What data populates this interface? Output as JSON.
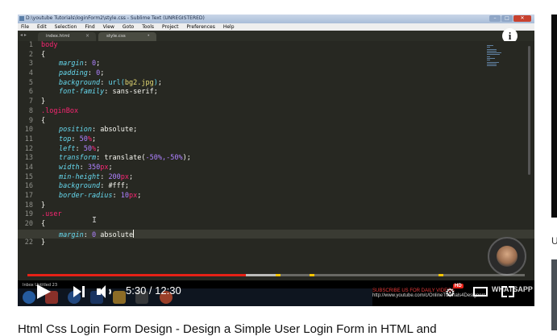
{
  "window": {
    "title": "D:\\youtube Tutorials\\loginForm2\\style.css - Sublime Text (UNREGISTERED)",
    "buttons": [
      "–",
      "□",
      "✕"
    ]
  },
  "menu": [
    "File",
    "Edit",
    "Selection",
    "Find",
    "View",
    "Goto",
    "Tools",
    "Project",
    "Preferences",
    "Help"
  ],
  "tabs": [
    {
      "label": "index.html",
      "close": "×",
      "active": false
    },
    {
      "label": "style.css",
      "close": "•",
      "active": true
    }
  ],
  "tab_nav": "◂ ▸",
  "info_button": "i",
  "line_numbers": [
    "1",
    "2",
    "3",
    "4",
    "5",
    "6",
    "7",
    "8",
    "9",
    "10",
    "11",
    "12",
    "13",
    "14",
    "15",
    "16",
    "17",
    "18",
    "19",
    "20",
    "21",
    "22"
  ],
  "code": {
    "l1": "body",
    "l2": "{",
    "l3": {
      "prop": "margin",
      "num": "0"
    },
    "l4": {
      "prop": "padding",
      "num": "0"
    },
    "l5": {
      "prop": "background",
      "func": "url(",
      "str": "bg2.jpg",
      "close": ")"
    },
    "l6": {
      "prop": "font-family",
      "val": "sans-serif"
    },
    "l7": "}",
    "l8": ".loginBox",
    "l9": "{",
    "l10": {
      "prop": "position",
      "val": "absolute"
    },
    "l11": {
      "prop": "top",
      "num": "50",
      "unit": "%"
    },
    "l12": {
      "prop": "left",
      "num": "50",
      "unit": "%"
    },
    "l13": {
      "prop": "transform",
      "func": "translate(",
      "args": "-50%,-50%",
      "close": ")"
    },
    "l14": {
      "prop": "width",
      "num": "350",
      "unit": "px"
    },
    "l15": {
      "prop": "min-height",
      "num": "200",
      "unit": "px"
    },
    "l16": {
      "prop": "background",
      "val": "#fff"
    },
    "l17": {
      "prop": "border-radius",
      "num": "10",
      "unit": "px"
    },
    "l18": "}",
    "l19": ".user",
    "l20": "{",
    "l21": {
      "prop": "margin",
      "num": "0",
      "val": "absolute"
    },
    "l22": "}"
  },
  "player": {
    "current_time": "5:30",
    "duration": "12:30",
    "time_separator": " / ",
    "progress": 0.44,
    "loaded": 0.5,
    "hd_label": "HD",
    "mini_tab": "Inbox Untitled 23",
    "subscribe_line1": "SUBSCRIBE US FOR DAILY VIDEOS",
    "subscribe_line2": "http://www.youtube.com/c/OnlineTutorials4Designers",
    "whatsapp": "WHATSAPP"
  },
  "video_title": "Html Css Login Form Design - Design a Simple User Login Form in HTML and",
  "side": {
    "letter": "U"
  },
  "colors": {
    "editor_bg": "#272822",
    "selector": "#f92672",
    "property": "#66d9ef",
    "number": "#ae81ff",
    "string": "#e6db74",
    "progress": "#e62117"
  }
}
